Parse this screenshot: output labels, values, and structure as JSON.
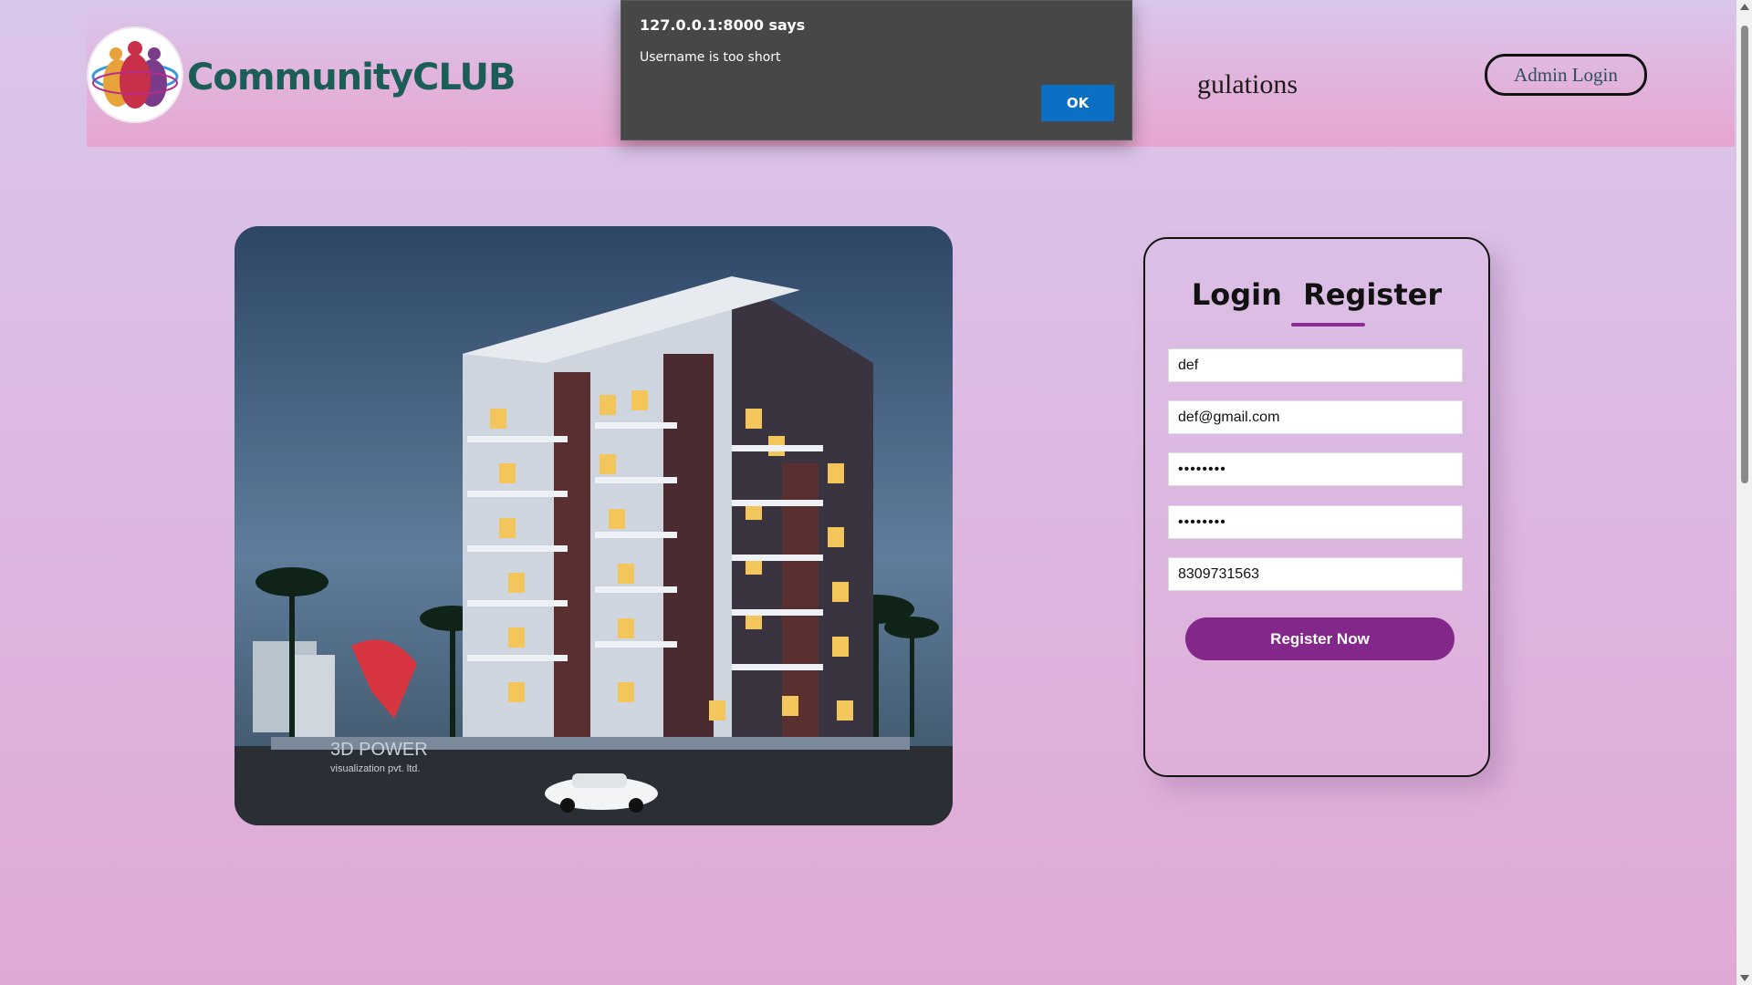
{
  "browser": {
    "dialog_origin": "127.0.0.1:8000 says"
  },
  "alert": {
    "title": "127.0.0.1:8000 says",
    "message": "Username is too short",
    "ok_label": "OK"
  },
  "header": {
    "brand": "CommunityCLUB",
    "nav_partial": "gulations",
    "admin_login_label": "Admin Login"
  },
  "form": {
    "tab_login": "Login",
    "tab_register": "Register",
    "fields": [
      {
        "name": "username",
        "value": "def"
      },
      {
        "name": "email",
        "value": "def@gmail.com"
      },
      {
        "name": "password",
        "value": "••••••••"
      },
      {
        "name": "confirm_password",
        "value": "••••••••"
      },
      {
        "name": "phone",
        "value": "8309731563"
      }
    ],
    "submit_label": "Register Now"
  },
  "image": {
    "watermark_line1": "3D POWER",
    "watermark_line2": "visualization pvt. ltd."
  },
  "colors": {
    "brand_text": "#1d5d58",
    "accent": "#83288a",
    "dialog_ok": "#0b6fc4"
  }
}
